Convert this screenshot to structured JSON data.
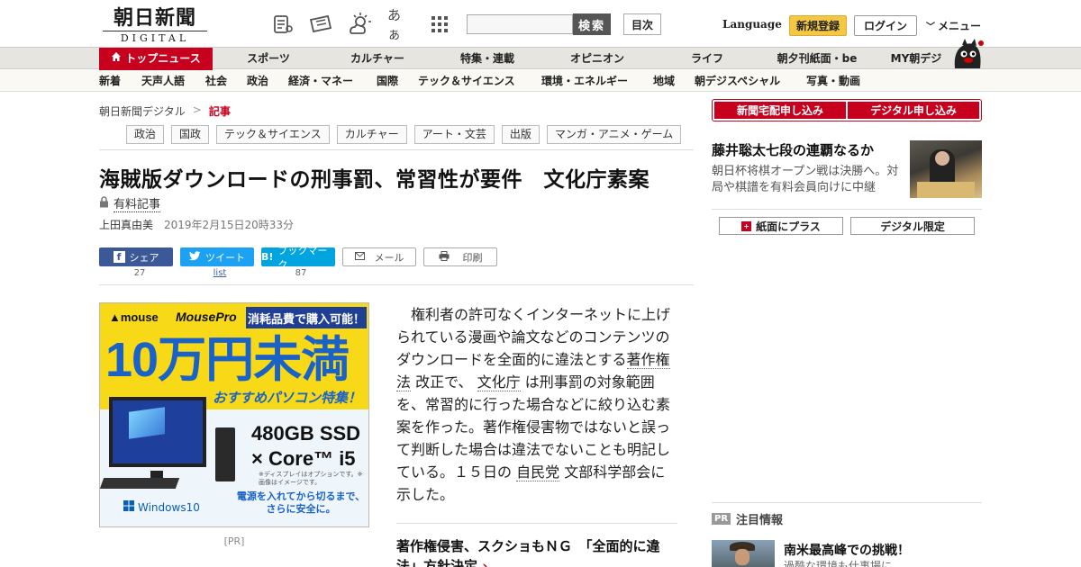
{
  "header": {
    "logo_jp": "朝日新聞",
    "logo_en": "DIGITAL",
    "icons": [
      "paper-icon",
      "ticket-icon",
      "weather-icon",
      "font-size-icon",
      "grid-icon"
    ],
    "font_size_label": "あぁ",
    "search_button": "検索",
    "search_placeholder": "",
    "toc_button": "目次",
    "language": "Language",
    "register": "新規登録",
    "login": "ログイン",
    "menu": "メニュー"
  },
  "mainnav": {
    "top": "トップニュース",
    "items": [
      "スポーツ",
      "カルチャー",
      "特集・連載",
      "オピニオン",
      "ライフ",
      "朝夕刊紙面・be",
      "MY朝デジ"
    ]
  },
  "subnav": {
    "items": [
      "新着",
      "天声人語",
      "社会",
      "政治",
      "経済・マネー",
      "国際",
      "テック＆サイエンス",
      "環境・エネルギー",
      "地域",
      "朝デジスペシャル",
      "写真・動画"
    ]
  },
  "breadcrumb": {
    "root": "朝日新聞デジタル",
    "separator": ">",
    "current": "記事"
  },
  "tags": [
    "政治",
    "国政",
    "テック＆サイエンス",
    "カルチャー",
    "アート・文芸",
    "出版",
    "マンガ・アニメ・ゲーム"
  ],
  "article": {
    "headline": "海賊版ダウンロードの刑事罰、常習性が要件　文化庁素案",
    "paid_label": "有料記事",
    "author": "上田真由美",
    "date": "2019年2月15日20時33分",
    "body_1": "　権利者の許可なくインターネットに上げられている漫画や論文などのコンテンツのダウンロードを全面的に違法とする",
    "kw_1": "著作権法",
    "body_2": "改正で、",
    "kw_2": "文化庁",
    "body_3": "は刑事罰の対象範囲を、常習的に行った場合などに絞り込む素案を作った。著作権侵害物ではないと誤って判断した場合は違法でないことも明記している。１５日の",
    "kw_3": "自民党",
    "body_4": "文部科学部会に示した。",
    "related": "著作権侵害、スクショもＮＧ　「全面的に違法」方針決定",
    "related_arrow": "›"
  },
  "share": {
    "facebook": "シェア",
    "facebook_count": "27",
    "twitter": "ツイート",
    "twitter_count": "list",
    "hatena": "ブックマーク",
    "hatena_icon": "B!",
    "hatena_count": "87",
    "mail": "メール",
    "print": "印刷"
  },
  "ad": {
    "brand": "mouse",
    "brand2": "MousePro",
    "promo": "消耗品費で購入可能！",
    "price": "10万円未満",
    "sub": "おすすめパソコン特集！",
    "spec1": "480GB SSD",
    "spec2": "× Core™ i5",
    "note": "※ディスプレイはオプションです。※画像はイメージです。",
    "note2": "電源を入れてから切るまで、さらに安全に。",
    "windows": "Windows10",
    "label": "[PR]"
  },
  "sidebar": {
    "btn_newspaper": "新聞宅配申し込み",
    "btn_digital": "デジタル申し込み",
    "feature_title": "藤井聡太七段の連覇なるか",
    "feature_desc": "朝日杯将棋オープン戦は決勝へ。対局や棋譜を有料会員向けに中継",
    "btn_plus": "紙面にプラス",
    "btn_limited": "デジタル限定",
    "plus_icon": "+",
    "pr_badge": "PR",
    "pr_heading": "注目情報",
    "pr_title": "南米最高峰での挑戦！",
    "pr_desc": "過酷な環境も仕事場に"
  },
  "colors": {
    "brand_red": "#c7001e",
    "register_yellow": "#f5c842",
    "facebook": "#3b5998",
    "twitter": "#1da1f2",
    "hatena": "#00a4de"
  }
}
